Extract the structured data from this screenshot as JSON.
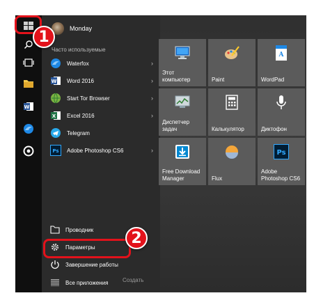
{
  "user": {
    "name": "Monday"
  },
  "section_label": "Часто используемые",
  "apps": [
    {
      "label": "Waterfox",
      "icon": "waterfox-icon"
    },
    {
      "label": "Word 2016",
      "icon": "word-icon"
    },
    {
      "label": "Start Tor Browser",
      "icon": "tor-icon"
    },
    {
      "label": "Excel 2016",
      "icon": "excel-icon"
    },
    {
      "label": "Telegram",
      "icon": "telegram-icon"
    },
    {
      "label": "Adobe Photoshop CS6",
      "icon": "photoshop-icon"
    }
  ],
  "bottom": {
    "explorer": "Проводник",
    "settings": "Параметры",
    "power": "Завершение работы",
    "all_apps": "Все приложения",
    "create": "Создать"
  },
  "tiles": [
    {
      "label": "Этот\nкомпьютер",
      "icon": "computer-icon"
    },
    {
      "label": "Paint",
      "icon": "paint-icon"
    },
    {
      "label": "WordPad",
      "icon": "wordpad-icon"
    },
    {
      "label": "Диспетчер\nзадач",
      "icon": "task-manager-icon"
    },
    {
      "label": "Калькулятор",
      "icon": "calculator-icon"
    },
    {
      "label": "Диктофон",
      "icon": "microphone-icon"
    },
    {
      "label": "Free Download\nManager",
      "icon": "fdm-icon"
    },
    {
      "label": "Flux",
      "icon": "flux-icon"
    },
    {
      "label": "Adobe\nPhotoshop CS6",
      "icon": "photoshop-icon"
    }
  ],
  "annotations": {
    "step1": "1",
    "step2": "2"
  },
  "colors": {
    "highlight": "#e3121b",
    "rail": "#0f0f0f",
    "menu": "#2b2b2b",
    "tile": "#5b5b5b"
  }
}
